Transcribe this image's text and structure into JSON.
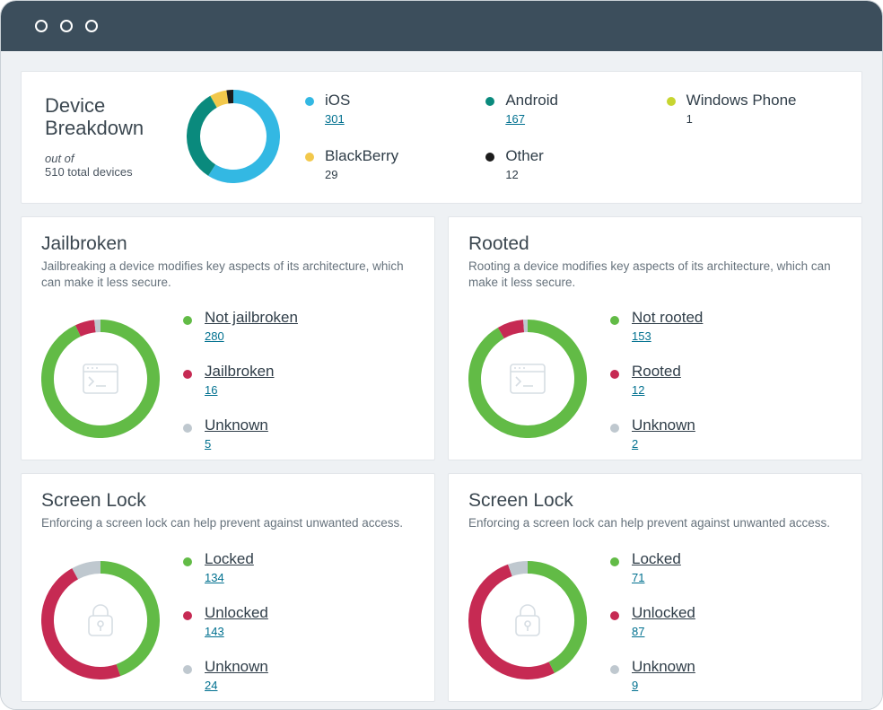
{
  "colors": {
    "ios": "#33b8e3",
    "android": "#0a8a7d",
    "windows": "#c7d530",
    "blackberry": "#f2c84b",
    "other": "#1c1c1c",
    "good": "#62bb46",
    "bad": "#c62a53",
    "unknown": "#bfc8cf"
  },
  "breakdown": {
    "title": "Device Breakdown",
    "sub_prefix": "out of",
    "sub_total": "510 total devices",
    "items": [
      {
        "label": "iOS",
        "value": "301",
        "link": true,
        "colorKey": "ios"
      },
      {
        "label": "Android",
        "value": "167",
        "link": true,
        "colorKey": "android"
      },
      {
        "label": "Windows Phone",
        "value": "1",
        "link": false,
        "colorKey": "windows"
      },
      {
        "label": "BlackBerry",
        "value": "29",
        "link": false,
        "colorKey": "blackberry"
      },
      {
        "label": "Other",
        "value": "12",
        "link": false,
        "colorKey": "other"
      }
    ]
  },
  "panels": [
    {
      "title": "Jailbroken",
      "desc": "Jailbreaking a device modifies key aspects of its architecture, which can make it less secure.",
      "icon": "terminal",
      "items": [
        {
          "label": "Not jailbroken",
          "value": "280",
          "colorKey": "good"
        },
        {
          "label": "Jailbroken",
          "value": "16",
          "colorKey": "bad"
        },
        {
          "label": "Unknown",
          "value": "5",
          "colorKey": "unknown"
        }
      ]
    },
    {
      "title": "Rooted",
      "desc": "Rooting a device modifies key aspects of its architecture, which can make it less secure.",
      "icon": "terminal",
      "items": [
        {
          "label": "Not rooted",
          "value": "153",
          "colorKey": "good"
        },
        {
          "label": "Rooted",
          "value": "12",
          "colorKey": "bad"
        },
        {
          "label": "Unknown",
          "value": "2",
          "colorKey": "unknown"
        }
      ]
    },
    {
      "title": "Screen Lock",
      "desc": "Enforcing a screen lock can help prevent against unwanted access.",
      "icon": "lock",
      "items": [
        {
          "label": "Locked",
          "value": "134",
          "colorKey": "good"
        },
        {
          "label": "Unlocked",
          "value": "143",
          "colorKey": "bad"
        },
        {
          "label": "Unknown",
          "value": "24",
          "colorKey": "unknown"
        }
      ]
    },
    {
      "title": "Screen Lock",
      "desc": "Enforcing a screen lock can help prevent against unwanted access.",
      "icon": "lock",
      "items": [
        {
          "label": "Locked",
          "value": "71",
          "colorKey": "good"
        },
        {
          "label": "Unlocked",
          "value": "87",
          "colorKey": "bad"
        },
        {
          "label": "Unknown",
          "value": "9",
          "colorKey": "unknown"
        }
      ]
    }
  ],
  "chart_data": [
    {
      "type": "pie",
      "title": "Device Breakdown",
      "series": [
        {
          "name": "iOS",
          "value": 301
        },
        {
          "name": "Android",
          "value": 167
        },
        {
          "name": "Windows Phone",
          "value": 1
        },
        {
          "name": "BlackBerry",
          "value": 29
        },
        {
          "name": "Other",
          "value": 12
        }
      ]
    },
    {
      "type": "pie",
      "title": "Jailbroken",
      "series": [
        {
          "name": "Not jailbroken",
          "value": 280
        },
        {
          "name": "Jailbroken",
          "value": 16
        },
        {
          "name": "Unknown",
          "value": 5
        }
      ]
    },
    {
      "type": "pie",
      "title": "Rooted",
      "series": [
        {
          "name": "Not rooted",
          "value": 153
        },
        {
          "name": "Rooted",
          "value": 12
        },
        {
          "name": "Unknown",
          "value": 2
        }
      ]
    },
    {
      "type": "pie",
      "title": "Screen Lock",
      "series": [
        {
          "name": "Locked",
          "value": 134
        },
        {
          "name": "Unlocked",
          "value": 143
        },
        {
          "name": "Unknown",
          "value": 24
        }
      ]
    },
    {
      "type": "pie",
      "title": "Screen Lock",
      "series": [
        {
          "name": "Locked",
          "value": 71
        },
        {
          "name": "Unlocked",
          "value": 87
        },
        {
          "name": "Unknown",
          "value": 9
        }
      ]
    }
  ]
}
